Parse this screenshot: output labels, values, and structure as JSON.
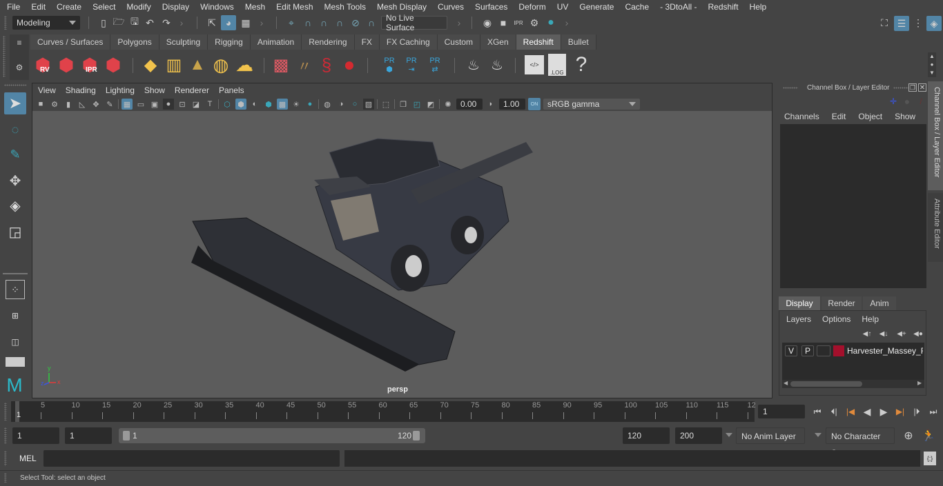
{
  "menubar": {
    "items": [
      "File",
      "Edit",
      "Create",
      "Select",
      "Modify",
      "Display",
      "Windows",
      "Mesh",
      "Edit Mesh",
      "Mesh Tools",
      "Mesh Display",
      "Curves",
      "Surfaces",
      "Deform",
      "UV",
      "Generate",
      "Cache",
      "- 3DtoAll -",
      "Redshift",
      "Help"
    ]
  },
  "statusline": {
    "workspace": "Modeling",
    "live_surface": "No Live Surface"
  },
  "shelf": {
    "tabs": [
      "Curves / Surfaces",
      "Polygons",
      "Sculpting",
      "Rigging",
      "Animation",
      "Rendering",
      "FX",
      "FX Caching",
      "Custom",
      "XGen",
      "Redshift",
      "Bullet"
    ],
    "active_tab": "Redshift",
    "icons": [
      {
        "name": "rv-icon",
        "label": "RV"
      },
      {
        "name": "render-clapper-icon",
        "label": ""
      },
      {
        "name": "ipr-icon",
        "label": "IPR"
      },
      {
        "name": "render-settings-icon",
        "label": ""
      },
      {
        "name": "light-diamond-icon",
        "label": ""
      },
      {
        "name": "area-light-icon",
        "label": ""
      },
      {
        "name": "spot-light-icon",
        "label": ""
      },
      {
        "name": "dome-light-icon",
        "label": ""
      },
      {
        "name": "sun-sky-icon",
        "label": ""
      },
      {
        "name": "proxy-cube-icon",
        "label": ""
      },
      {
        "name": "hair-icon",
        "label": ""
      },
      {
        "name": "material-ribbon-icon",
        "label": ""
      },
      {
        "name": "material-sphere-icon",
        "label": ""
      },
      {
        "name": "pr-mesh-icon",
        "label": "PR"
      },
      {
        "name": "pr-export-icon",
        "label": "PR"
      },
      {
        "name": "pr-transfer-icon",
        "label": "PR"
      },
      {
        "name": "pie-multi-icon",
        "label": ""
      },
      {
        "name": "pie-single-icon",
        "label": ""
      },
      {
        "name": "script-editor-icon",
        "label": "</>"
      },
      {
        "name": "log-icon",
        "label": ".LOG"
      },
      {
        "name": "help-icon",
        "label": "?"
      }
    ]
  },
  "viewport": {
    "menu": [
      "View",
      "Shading",
      "Lighting",
      "Show",
      "Renderer",
      "Panels"
    ],
    "exposure": "0.00",
    "gamma": "1.00",
    "color_space": "sRGB gamma",
    "color_mgmt_badge": "ON",
    "camera_label": "persp",
    "axis": {
      "x": "x",
      "y": "y",
      "z": "z"
    }
  },
  "channel_box": {
    "title": "Channel Box / Layer Editor",
    "menu": [
      "Channels",
      "Edit",
      "Object",
      "Show"
    ]
  },
  "layer_editor": {
    "tabs": [
      "Display",
      "Render",
      "Anim"
    ],
    "active_tab": "Display",
    "menu": [
      "Layers",
      "Options",
      "Help"
    ],
    "layers": [
      {
        "visible": "V",
        "playback": "P",
        "color": "#a4102c",
        "name": "Harvester_Massey_Ferg"
      }
    ]
  },
  "side_tabs": [
    "Channel Box / Layer Editor",
    "Attribute Editor"
  ],
  "timeline": {
    "ticks": [
      "5",
      "10",
      "15",
      "20",
      "25",
      "30",
      "35",
      "40",
      "45",
      "50",
      "55",
      "60",
      "65",
      "70",
      "75",
      "80",
      "85",
      "90",
      "95",
      "100",
      "105",
      "110",
      "115",
      "12"
    ],
    "current_frame_marker": "1",
    "current_frame": "1"
  },
  "range": {
    "start": "1",
    "playback_start": "1",
    "slider_start": "1",
    "slider_end": "120",
    "playback_end": "120",
    "end": "200",
    "anim_layer": "No Anim Layer",
    "character_set": "No Character Set"
  },
  "command_line": {
    "language": "MEL",
    "input": "",
    "result": ""
  },
  "help_line": "Select Tool: select an object",
  "colors": {
    "accent": "#5285a6",
    "layer_color": "#a4102c",
    "playhead": "#e08a3c"
  }
}
